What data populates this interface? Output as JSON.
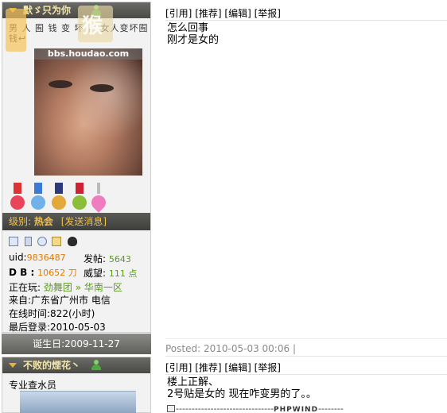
{
  "post1": {
    "author": {
      "name": "默ゞ只为你",
      "signature": "男 人 囿 钱 变 坏 ， 女人变坏囿钱↩",
      "watermark": "bbs.houdao.com",
      "level_label": "级别:",
      "level_value": "热会",
      "send_message": "[发送消息]",
      "uid_label": "uid:",
      "uid_value": "9836487",
      "posts_label": "发帖:",
      "posts_value": "5643",
      "db_label": "D B :",
      "db_value": "10652 刀",
      "prestige_label": "威望:",
      "prestige_value": "111 点",
      "playing_label": "正在玩:",
      "playing_value": "劲舞团 » 华南一区",
      "from_label": "来自:",
      "from_value": "广东省广州市 电信",
      "online_label": "在线时间:",
      "online_value": "822(小时)",
      "last_login_label": "最后登录:",
      "last_login_value": "2010-05-03",
      "birthday_label": "诞生日:",
      "birthday_value": "2009-11-27"
    },
    "actions": [
      "[引用]",
      "[推荐]",
      "[编辑]",
      "[举报]"
    ],
    "content_lines": [
      "怎么回事",
      "刚才是女的"
    ]
  },
  "post2": {
    "posted_label": "Posted:",
    "posted_value": "2010-05-03 00:06",
    "posted_sep": "|",
    "author": {
      "name": "不败的煙花丶",
      "title": "专业查水员"
    },
    "actions": [
      "[引用]",
      "[推荐]",
      "[编辑]",
      "[举报]"
    ],
    "content_lines": [
      "楼上正解、",
      "2号贴是女的  现在咋变男的了。。"
    ],
    "signature_dashes": "-------------------------------",
    "signature_brand": "PHPWIND",
    "signature_tail": "--------"
  },
  "colors": {
    "header_dark": "#4a4a46",
    "name_text": "#f6e7a8",
    "level_text": "#f2c14e",
    "orange": "#e07b00",
    "green": "#5a9a1e",
    "panel_bg": "#f2f2f2"
  },
  "icons": [
    "triangle-down-icon",
    "user-online-icon",
    "profile-card-icon",
    "phone-icon",
    "add-friend-icon",
    "message-icon",
    "qq-icon",
    "edit-pencil-icon"
  ]
}
